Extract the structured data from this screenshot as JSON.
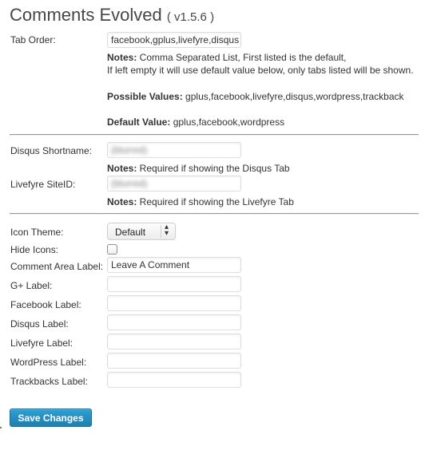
{
  "header": {
    "title": "Comments Evolved",
    "version": "( v1.5.6 )"
  },
  "tab_order": {
    "label": "Tab Order:",
    "value": "facebook,gplus,livefyre,disqus",
    "notes_label": "Notes:",
    "notes_text": " Comma Separated List, First listed is the default,",
    "notes_line2": "If left empty it will use default value below, only tabs listed will be shown.",
    "possible_label": "Possible Values:",
    "possible_text": " gplus,facebook,livefyre,disqus,wordpress,trackback",
    "default_label": "Default Value:",
    "default_text": " gplus,facebook,wordpress"
  },
  "disqus": {
    "label": "Disqus Shortname:",
    "value": "(blurred)",
    "notes_label": "Notes:",
    "notes_text": " Required if showing the Disqus Tab"
  },
  "livefyre": {
    "label": "Livefyre SiteID:",
    "value": "(blurred)",
    "notes_label": "Notes:",
    "notes_text": " Required if showing the Livefyre Tab"
  },
  "icon_theme": {
    "label": "Icon Theme:",
    "selected": "Default"
  },
  "hide_icons": {
    "label": "Hide Icons:",
    "checked": false
  },
  "fields": [
    {
      "label": "Comment Area Label:",
      "value": "Leave A Comment"
    },
    {
      "label": "G+ Label:",
      "value": ""
    },
    {
      "label": "Facebook Label:",
      "value": ""
    },
    {
      "label": "Disqus Label:",
      "value": ""
    },
    {
      "label": "Livefyre Label:",
      "value": ""
    },
    {
      "label": "WordPress Label:",
      "value": ""
    },
    {
      "label": "Trackbacks Label:",
      "value": ""
    }
  ],
  "actions": {
    "save_label": "Save Changes"
  },
  "colors": {
    "primary_button": "#2185b5",
    "divider": "#999999"
  }
}
